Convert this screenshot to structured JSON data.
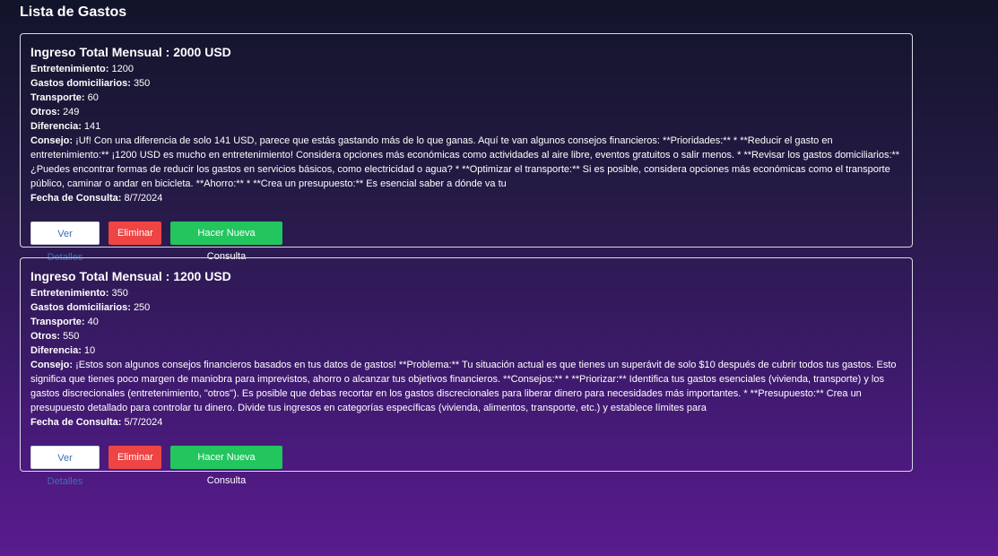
{
  "page": {
    "title": "Lista de Gastos"
  },
  "labels": {
    "entertainment": "Entretenimiento:",
    "household": "Gastos domiciliarios:",
    "transport": "Transporte:",
    "other": "Otros:",
    "difference": "Diferencia:",
    "advice": "Consejo:",
    "date": "Fecha de Consulta:"
  },
  "buttons": {
    "details": "Ver Detalles",
    "delete": "Eliminar",
    "new_query": "Hacer Nueva Consulta"
  },
  "cards": [
    {
      "title": "Ingreso Total Mensual : 2000 USD",
      "entertainment": "1200",
      "household": "350",
      "transport": "60",
      "other": "249",
      "difference": "141",
      "advice": "¡Uf! Con una diferencia de solo 141 USD, parece que estás gastando más de lo que ganas. Aquí te van algunos consejos financieros: **Prioridades:** * **Reducir el gasto en entretenimiento:** ¡1200 USD es mucho en entretenimiento! Considera opciones más económicas como actividades al aire libre, eventos gratuitos o salir menos. * **Revisar los gastos domiciliarios:** ¿Puedes encontrar formas de reducir los gastos en servicios básicos, como electricidad o agua? * **Optimizar el transporte:** Si es posible, considera opciones más económicas como el transporte público, caminar o andar en bicicleta. **Ahorro:** * **Crea un presupuesto:** Es esencial saber a dónde va tu",
      "date": "8/7/2024"
    },
    {
      "title": "Ingreso Total Mensual : 1200 USD",
      "entertainment": "350",
      "household": "250",
      "transport": "40",
      "other": "550",
      "difference": "10",
      "advice": "¡Estos son algunos consejos financieros basados en tus datos de gastos! **Problema:** Tu situación actual es que tienes un superávit de solo $10 después de cubrir todos tus gastos. Esto significa que tienes poco margen de maniobra para imprevistos, ahorro o alcanzar tus objetivos financieros. **Consejos:** * **Priorizar:** Identifica tus gastos esenciales (vivienda, transporte) y los gastos discrecionales (entretenimiento, \"otros\"). Es posible que debas recortar en los gastos discrecionales para liberar dinero para necesidades más importantes. * **Presupuesto:** Crea un presupuesto detallado para controlar tu dinero. Divide tus ingresos en categorías específicas (vivienda, alimentos, transporte, etc.) y establece límites para",
      "date": "5/7/2024"
    }
  ]
}
